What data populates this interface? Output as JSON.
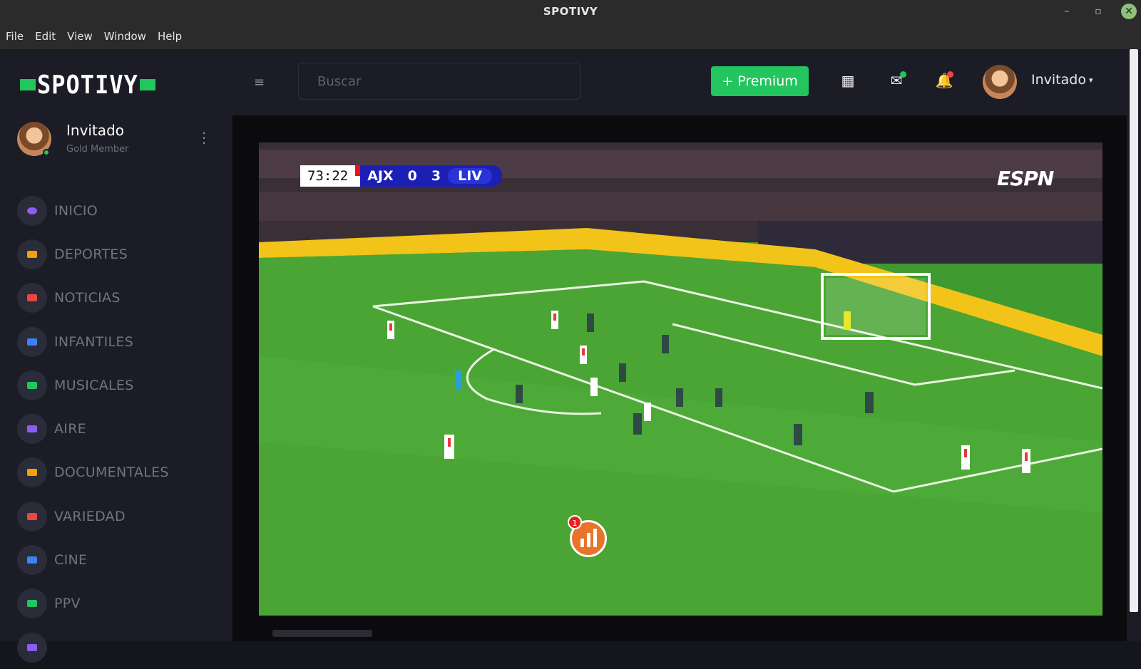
{
  "window": {
    "title": "SPOTIVY",
    "controls": {
      "minimize": "–",
      "maximize": "▫",
      "close": "✕"
    }
  },
  "menubar": [
    "File",
    "Edit",
    "View",
    "Window",
    "Help"
  ],
  "sidebar": {
    "logo": "SPOTIVY",
    "user": {
      "name": "Invitado",
      "role": "Gold Member"
    },
    "menu_icon": "⋮",
    "items": [
      {
        "label": "INICIO",
        "color": "#8b5cf6"
      },
      {
        "label": "DEPORTES",
        "color": "#f59e0b"
      },
      {
        "label": "NOTICIAS",
        "color": "#ef4444"
      },
      {
        "label": "INFANTILES",
        "color": "#3b82f6"
      },
      {
        "label": "MUSICALES",
        "color": "#22c55e"
      },
      {
        "label": "AIRE",
        "color": "#8b5cf6"
      },
      {
        "label": "DOCUMENTALES",
        "color": "#f59e0b"
      },
      {
        "label": "VARIEDAD",
        "color": "#ef4444"
      },
      {
        "label": "CINE",
        "color": "#3b82f6"
      },
      {
        "label": "PPV",
        "color": "#22c55e"
      }
    ]
  },
  "topbar": {
    "hamburger": "≡",
    "search_placeholder": "Buscar",
    "premium_label": "+ Premium",
    "icons": {
      "apps": "▦",
      "mail": "✉",
      "bell": "🔔"
    },
    "user_name": "Invitado",
    "caret": "▾"
  },
  "video": {
    "clock": "73:22",
    "home_team": "AJX",
    "home_score": "0",
    "away_score": "3",
    "away_team": "LIV",
    "broadcaster": "ESPN",
    "stats_badge": "1"
  },
  "colors": {
    "accent": "#22c55e",
    "background": "#15161c",
    "sidebar": "#1b1c25"
  }
}
